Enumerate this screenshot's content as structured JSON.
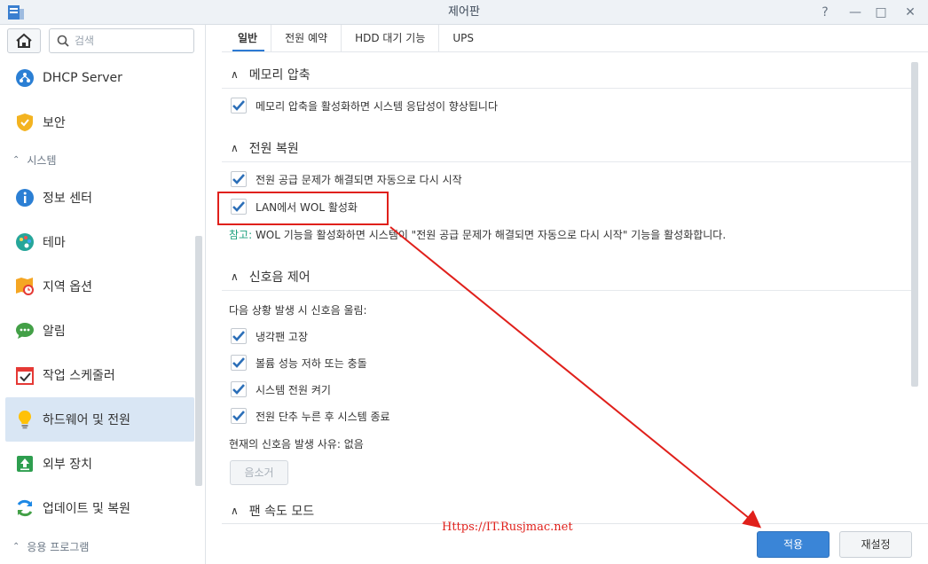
{
  "window": {
    "title": "제어판",
    "controls": {
      "help": "?",
      "minimize": "—",
      "maximize": "□",
      "close": "✕"
    }
  },
  "sidebar": {
    "search_placeholder": "검색",
    "items": [
      {
        "label": "DHCP Server",
        "icon": "dhcp-server-icon"
      },
      {
        "label": "보안",
        "icon": "shield-icon"
      },
      {
        "section": "시스템"
      },
      {
        "label": "정보 센터",
        "icon": "info-icon"
      },
      {
        "label": "테마",
        "icon": "palette-icon"
      },
      {
        "label": "지역 옵션",
        "icon": "region-clock-icon"
      },
      {
        "label": "알림",
        "icon": "chat-bubble-icon"
      },
      {
        "label": "작업 스케줄러",
        "icon": "calendar-check-icon"
      },
      {
        "label": "하드웨어 및 전원",
        "icon": "lightbulb-icon",
        "active": true
      },
      {
        "label": "외부 장치",
        "icon": "upload-icon"
      },
      {
        "label": "업데이트 및 복원",
        "icon": "refresh-icon"
      },
      {
        "section": "응용 프로그램"
      }
    ]
  },
  "tabs": [
    {
      "label": "일반",
      "active": true
    },
    {
      "label": "전원 예약"
    },
    {
      "label": "HDD 대기 기능"
    },
    {
      "label": "UPS"
    }
  ],
  "sections": {
    "memory": {
      "title": "메모리 압축",
      "options": [
        {
          "label": "메모리 압축을 활성화하면 시스템 응답성이 향상됩니다",
          "checked": true
        }
      ]
    },
    "power": {
      "title": "전원 복원",
      "options": [
        {
          "label": "전원 공급 문제가 해결되면 자동으로 다시 시작",
          "checked": true
        },
        {
          "label": "LAN에서 WOL 활성화",
          "checked": true
        }
      ],
      "note_lead": "참고:",
      "note": " WOL 기능을 활성화하면 시스템이 \"전원 공급 문제가 해결되면 자동으로 다시 시작\" 기능을 활성화합니다."
    },
    "beep": {
      "title": "신호음 제어",
      "intro": "다음 상황 발생 시 신호음 울림:",
      "options": [
        {
          "label": "냉각팬 고장",
          "checked": true
        },
        {
          "label": "볼륨 성능 저하 또는 충돌",
          "checked": true
        },
        {
          "label": "시스템 전원 켜기",
          "checked": true
        },
        {
          "label": "전원 단추 누른 후 시스템 종료",
          "checked": true
        }
      ],
      "current_reason": "현재의 신호음 발생 사유: 없음",
      "mute_button": "음소거"
    },
    "fan": {
      "title": "팬 속도 모드"
    }
  },
  "footer": {
    "apply": "적용",
    "reset": "재설정"
  },
  "watermark": "Https://IT.Rusjmac.net",
  "colors": {
    "accent": "#3a85d7",
    "annotation_red": "#e0201b",
    "note_green": "#1a9f7d",
    "active_item_bg": "#d9e6f4"
  }
}
